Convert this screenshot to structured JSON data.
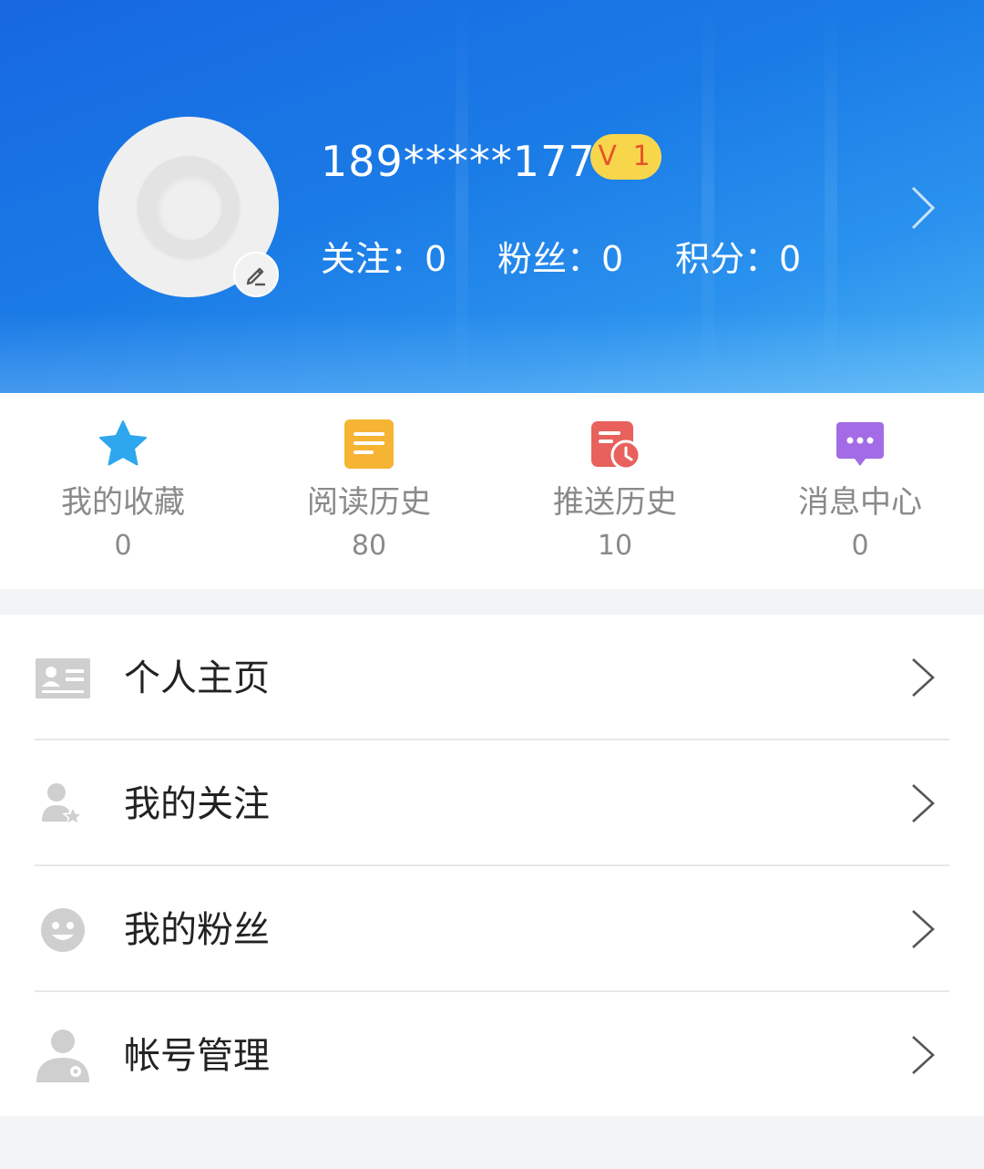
{
  "profile": {
    "phone": "189*****177",
    "level_badge": "V 1",
    "stats": [
      {
        "label": "关注",
        "sep": "：",
        "value": "0"
      },
      {
        "label": "粉丝",
        "sep": "：",
        "value": "0"
      },
      {
        "label": "积分",
        "sep": "：",
        "value": "0"
      }
    ]
  },
  "shortcuts": [
    {
      "label": "我的收藏",
      "count": "0",
      "icon": "star-icon",
      "color": "#2ea7ee"
    },
    {
      "label": "阅读历史",
      "count": "80",
      "icon": "document-icon",
      "color": "#f5b433"
    },
    {
      "label": "推送历史",
      "count": "10",
      "icon": "calendar-clock-icon",
      "color": "#e8615d"
    },
    {
      "label": "消息中心",
      "count": "0",
      "icon": "chat-bubble-icon",
      "color": "#a36ce6"
    }
  ],
  "menu": [
    {
      "label": "个人主页",
      "icon": "id-card-icon"
    },
    {
      "label": "我的关注",
      "icon": "user-star-icon"
    },
    {
      "label": "我的粉丝",
      "icon": "smiley-face-icon"
    },
    {
      "label": "帐号管理",
      "icon": "user-gear-icon"
    }
  ],
  "colors": {
    "header_gradient_start": "#1767e0",
    "header_gradient_end": "#4db2f4",
    "badge_bg": "#f8d64c",
    "badge_text": "#e6542b"
  }
}
